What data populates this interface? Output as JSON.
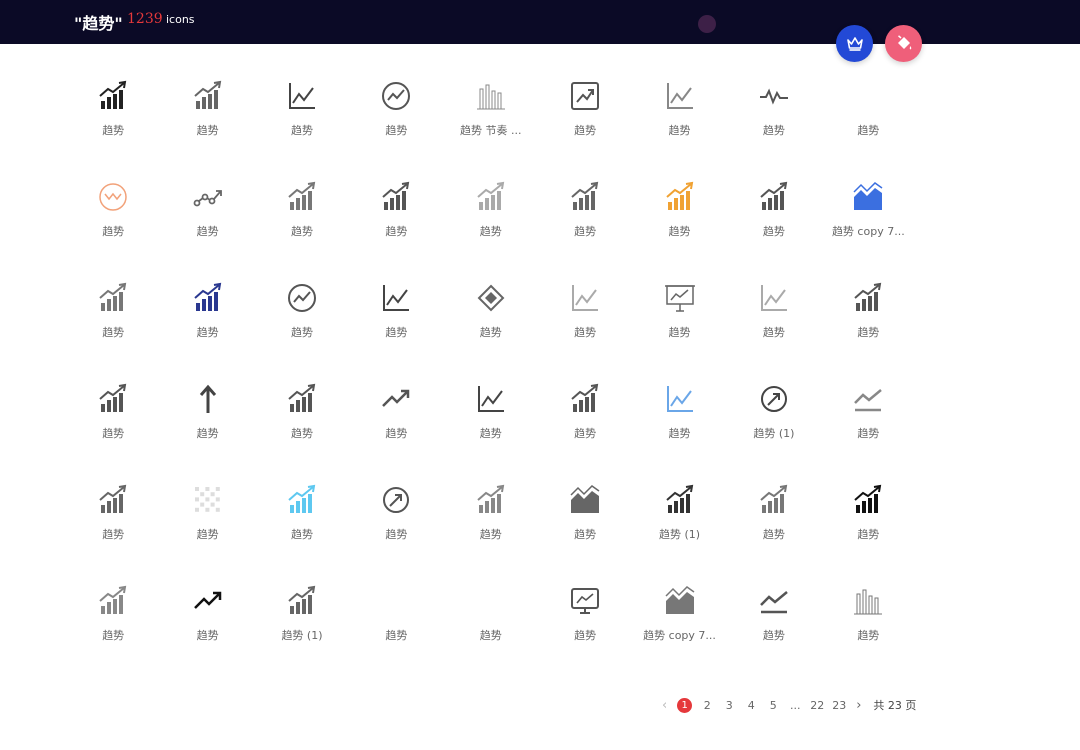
{
  "header": {
    "title": "\"趋势\"",
    "count": "1239",
    "unit": "icons",
    "colors": {
      "bg": "#0b0a26",
      "count": "#e5383b",
      "crown_button": "#2349d6",
      "paint_button": "#ef5f7a"
    }
  },
  "icons": [
    {
      "label": "趋势",
      "icon": "bar-chart-up-arrow-icon"
    },
    {
      "label": "趋势",
      "icon": "bar-chart-up-arrow-icon"
    },
    {
      "label": "趋势",
      "icon": "line-chart-axes-icon"
    },
    {
      "label": "趋势",
      "icon": "circle-trend-icon"
    },
    {
      "label": "趋势 节奏 ...",
      "icon": "column-bars-icon"
    },
    {
      "label": "趋势",
      "icon": "framed-trend-icon"
    },
    {
      "label": "趋势",
      "icon": "line-chart-axes-icon"
    },
    {
      "label": "趋势",
      "icon": "pulse-wave-icon"
    },
    {
      "label": "趋势",
      "icon": "blank-icon"
    },
    {
      "label": "趋势",
      "icon": "circle-wave-icon"
    },
    {
      "label": "趋势",
      "icon": "dot-trend-icon"
    },
    {
      "label": "趋势",
      "icon": "bar-chart-up-arrow-icon"
    },
    {
      "label": "趋势",
      "icon": "bar-chart-up-arrow-icon"
    },
    {
      "label": "趋势",
      "icon": "bar-chart-up-arrow-icon"
    },
    {
      "label": "趋势",
      "icon": "bar-chart-up-arrow-icon"
    },
    {
      "label": "趋势",
      "icon": "bar-chart-up-arrow-icon"
    },
    {
      "label": "趋势",
      "icon": "bar-chart-up-arrow-icon"
    },
    {
      "label": "趋势 copy 7...",
      "icon": "area-chart-icon"
    },
    {
      "label": "趋势",
      "icon": "bar-chart-up-arrow-icon"
    },
    {
      "label": "趋势",
      "icon": "bar-chart-up-arrow-icon"
    },
    {
      "label": "趋势",
      "icon": "circle-trend-icon"
    },
    {
      "label": "趋势",
      "icon": "line-chart-axes-icon"
    },
    {
      "label": "趋势",
      "icon": "diamond-icon"
    },
    {
      "label": "趋势",
      "icon": "line-chart-axes-icon"
    },
    {
      "label": "趋势",
      "icon": "presentation-board-icon"
    },
    {
      "label": "趋势",
      "icon": "line-chart-axes-icon"
    },
    {
      "label": "趋势",
      "icon": "bar-chart-up-arrow-icon"
    },
    {
      "label": "趋势",
      "icon": "bar-chart-up-arrow-icon"
    },
    {
      "label": "趋势",
      "icon": "up-arrow-icon"
    },
    {
      "label": "趋势",
      "icon": "bar-chart-up-arrow-icon"
    },
    {
      "label": "趋势",
      "icon": "trend-arrow-icon"
    },
    {
      "label": "趋势",
      "icon": "line-chart-axes-icon"
    },
    {
      "label": "趋势",
      "icon": "bar-chart-up-arrow-icon"
    },
    {
      "label": "趋势",
      "icon": "line-chart-axes-icon"
    },
    {
      "label": "趋势 (1)",
      "icon": "circle-arrow-icon"
    },
    {
      "label": "趋势",
      "icon": "trend-underline-icon"
    },
    {
      "label": "趋势",
      "icon": "bar-chart-up-arrow-icon"
    },
    {
      "label": "趋势",
      "icon": "grid-pattern-icon"
    },
    {
      "label": "趋势",
      "icon": "bar-chart-up-arrow-icon"
    },
    {
      "label": "趋势",
      "icon": "circle-arrow-icon"
    },
    {
      "label": "趋势",
      "icon": "bar-chart-up-arrow-icon"
    },
    {
      "label": "趋势",
      "icon": "area-chart-icon"
    },
    {
      "label": "趋势 (1)",
      "icon": "bar-chart-up-arrow-icon"
    },
    {
      "label": "趋势",
      "icon": "bar-chart-up-arrow-icon"
    },
    {
      "label": "趋势",
      "icon": "bar-chart-up-arrow-icon"
    },
    {
      "label": "趋势",
      "icon": "bar-chart-up-arrow-icon"
    },
    {
      "label": "趋势",
      "icon": "trend-arrow-icon"
    },
    {
      "label": "趋势 (1)",
      "icon": "bar-chart-up-arrow-icon"
    },
    {
      "label": "趋势",
      "icon": "blank-icon"
    },
    {
      "label": "趋势",
      "icon": "blank-icon"
    },
    {
      "label": "趋势",
      "icon": "monitor-trend-icon"
    },
    {
      "label": "趋势 copy 7...",
      "icon": "area-chart-icon"
    },
    {
      "label": "趋势",
      "icon": "trend-underline-icon"
    },
    {
      "label": "趋势",
      "icon": "column-bars-icon"
    }
  ],
  "pagination": {
    "prev": "‹",
    "pages": [
      "1",
      "2",
      "3",
      "4",
      "5",
      "...",
      "22",
      "23"
    ],
    "current": "1",
    "next": "›",
    "total": "共 23 页"
  }
}
